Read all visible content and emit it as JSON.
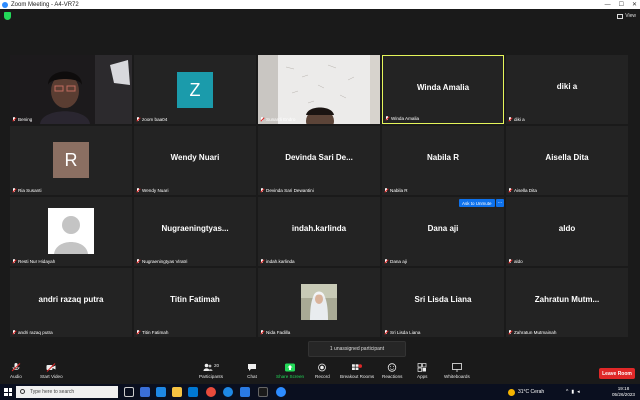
{
  "window": {
    "title": "Zoom Meeting - A4-VR72",
    "view_label": "View"
  },
  "tiles": [
    {
      "name": "",
      "label": "Bening"
    },
    {
      "name": "",
      "label": "zoom baa04",
      "initial": "Z",
      "avatar_color": "#1b9bab"
    },
    {
      "name": "",
      "label": "Sunardi Endro"
    },
    {
      "name": "Winda Amalia",
      "label": "Winda Amalia"
    },
    {
      "name": "diki a",
      "label": "diki a"
    },
    {
      "name": "",
      "label": "Ria Susanti",
      "initial": "R",
      "avatar_color": "#8b6f62"
    },
    {
      "name": "Wendy Nuari",
      "label": "Wendy Nuari"
    },
    {
      "name": "Devinda Sari De...",
      "label": "Devinda Sari Dewantini"
    },
    {
      "name": "Nabila R",
      "label": "Nabila R"
    },
    {
      "name": "Aisella Dita",
      "label": "Aisella Dita"
    },
    {
      "name": "",
      "label": "Resti Nur Hidayah"
    },
    {
      "name": "Nugraeningtyas...",
      "label": "Nugraeningtyas Viratri"
    },
    {
      "name": "indah.karlinda",
      "label": "indah.karlinda"
    },
    {
      "name": "Dana aji",
      "label": "Dana aji"
    },
    {
      "name": "aldo",
      "label": "aldo"
    },
    {
      "name": "andri razaq putra",
      "label": "andri razaq putra"
    },
    {
      "name": "Titin Fatimah",
      "label": "Titin Fatimah"
    },
    {
      "name": "",
      "label": "Nida Fadilla"
    },
    {
      "name": "Sri Lisda Liana",
      "label": "Sri Lisda Liana"
    },
    {
      "name": "Zahratun Mutm...",
      "label": "Zahratun Mutmainah"
    }
  ],
  "hover": {
    "ask_unmute": "Ask to Unmute",
    "more": "···"
  },
  "toast": "1 unassigned participant",
  "controls": {
    "audio": "Audio",
    "start_video": "Start Video",
    "participants": "Participants",
    "participants_count": "20",
    "chat": "Chat",
    "share_screen": "Share Screen",
    "record": "Record",
    "breakout_rooms": "Breakout Rooms",
    "reactions": "Reactions",
    "apps": "Apps",
    "whiteboards": "Whiteboards",
    "leave_room": "Leave Room",
    "accent": "#23d959",
    "leave_color": "#e02828"
  },
  "taskbar": {
    "search_placeholder": "Type here to search",
    "weather": "31°C  Cerah",
    "time": "19:18",
    "date": "05/26/2023"
  }
}
